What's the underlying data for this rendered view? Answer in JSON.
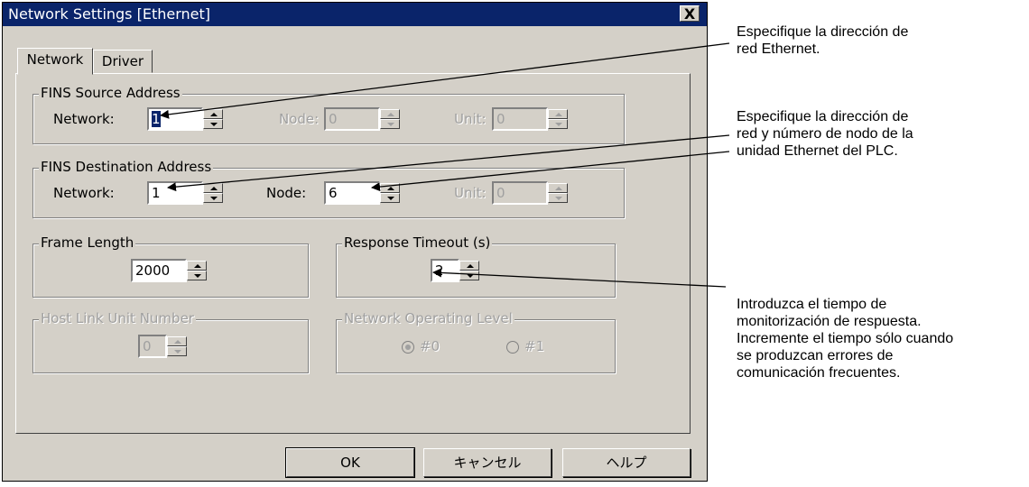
{
  "window": {
    "title": "Network Settings [Ethernet]",
    "close_glyph": "X"
  },
  "tabs": [
    {
      "label": "Network",
      "active": true
    },
    {
      "label": "Driver",
      "active": false
    }
  ],
  "source": {
    "legend": "FINS Source Address",
    "network_label": "Network:",
    "network_value": "1",
    "node_label": "Node:",
    "node_value": "0",
    "unit_label": "Unit:",
    "unit_value": "0"
  },
  "destination": {
    "legend": "FINS Destination Address",
    "network_label": "Network:",
    "network_value": "1",
    "node_label": "Node:",
    "node_value": "6",
    "unit_label": "Unit:",
    "unit_value": "0"
  },
  "frame": {
    "legend": "Frame Length",
    "value": "2000"
  },
  "timeout": {
    "legend": "Response Timeout (s)",
    "value": "2"
  },
  "hostlink": {
    "legend": "Host Link Unit Number",
    "value": "0"
  },
  "level": {
    "legend": "Network Operating Level",
    "opt0": "#0",
    "opt1": "#1"
  },
  "buttons": {
    "ok": "OK",
    "cancel": "キャンセル",
    "help": "ヘルプ"
  },
  "annotations": {
    "a1": [
      "Especifique la dirección de",
      "red Ethernet."
    ],
    "a2": [
      "Especifique la dirección de",
      "red y número de nodo de la",
      "unidad Ethernet del PLC."
    ],
    "a3": [
      "Introduzca el tiempo de",
      "monitorización de respuesta.",
      "Incremente el tiempo sólo cuando",
      "se produzcan errores de",
      "comunicación frecuentes."
    ]
  },
  "colors": {
    "titlebar": "#0a246a",
    "face": "#d4d0c8",
    "disabled_text": "#a0a0a0"
  }
}
